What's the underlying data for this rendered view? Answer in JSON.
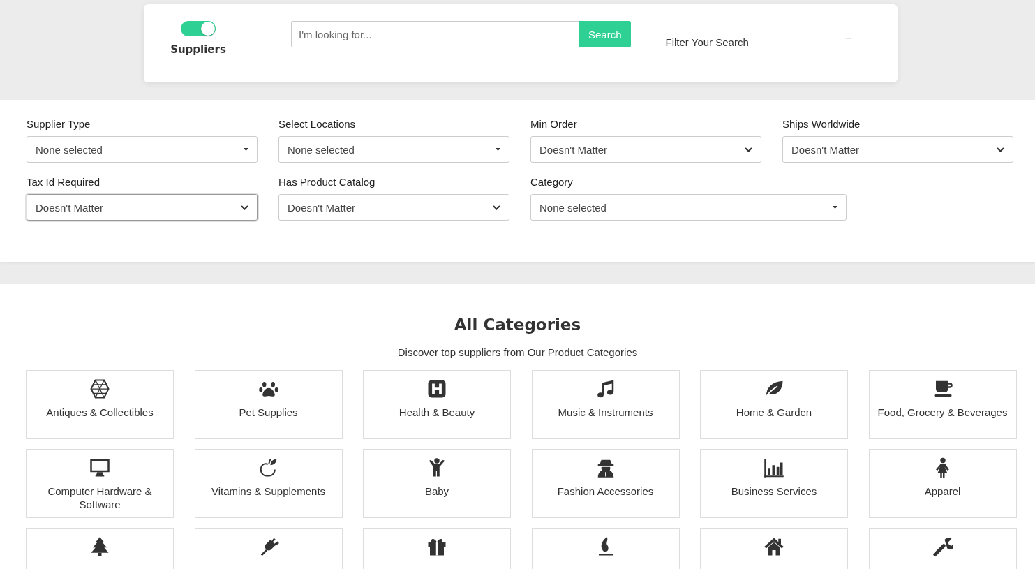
{
  "search_bar": {
    "toggle": {
      "label": "Suppliers",
      "on": true
    },
    "search": {
      "placeholder": "I'm looking for...",
      "button": "Search"
    },
    "filter_title": "Filter Your Search",
    "collapse": "−"
  },
  "filters": [
    {
      "label": "Supplier Type",
      "kind": "multiselect",
      "value": "None selected",
      "focused": false
    },
    {
      "label": "Select Locations",
      "kind": "multiselect",
      "value": "None selected",
      "focused": false
    },
    {
      "label": "Min Order",
      "kind": "select",
      "value": "Doesn't Matter",
      "focused": false
    },
    {
      "label": "Ships Worldwide",
      "kind": "select",
      "value": "Doesn't Matter",
      "focused": false
    },
    {
      "label": "Tax Id Required",
      "kind": "select",
      "value": "Doesn't Matter",
      "focused": true
    },
    {
      "label": "Has Product Catalog",
      "kind": "select",
      "value": "Doesn't Matter",
      "focused": false
    },
    {
      "label": "Category",
      "kind": "multiselect",
      "value": "None selected",
      "focused": false
    }
  ],
  "categories_section": {
    "title": "All Categories",
    "subtitle": "Discover top suppliers from Our Product Categories",
    "items": [
      {
        "label": "Antiques & Collectibles"
      },
      {
        "label": "Pet Supplies"
      },
      {
        "label": "Health & Beauty"
      },
      {
        "label": "Music & Instruments"
      },
      {
        "label": "Home & Garden"
      },
      {
        "label": "Food, Grocery & Beverages"
      },
      {
        "label": "Computer Hardware & Software"
      },
      {
        "label": "Vitamins & Supplements"
      },
      {
        "label": "Baby"
      },
      {
        "label": "Fashion Accessories"
      },
      {
        "label": "Business Services"
      },
      {
        "label": "Apparel"
      },
      {
        "kind": "partial"
      },
      {
        "kind": "partial"
      },
      {
        "kind": "partial"
      },
      {
        "kind": "partial"
      },
      {
        "kind": "partial"
      },
      {
        "kind": "partial"
      }
    ]
  }
}
